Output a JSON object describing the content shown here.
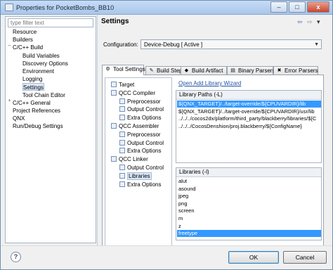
{
  "window": {
    "title": "Properties for PocketBombs_BB10",
    "controls": [
      "–",
      "□",
      "x"
    ]
  },
  "filter": {
    "placeholder": "type filter text"
  },
  "tree": [
    {
      "label": "Resource",
      "indent": 0,
      "expander": ""
    },
    {
      "label": "Builders",
      "indent": 0,
      "expander": ""
    },
    {
      "label": "C/C++ Build",
      "indent": 0,
      "expander": "–"
    },
    {
      "label": "Build Variables",
      "indent": 1,
      "expander": ""
    },
    {
      "label": "Discovery Options",
      "indent": 1,
      "expander": ""
    },
    {
      "label": "Environment",
      "indent": 1,
      "expander": ""
    },
    {
      "label": "Logging",
      "indent": 1,
      "expander": ""
    },
    {
      "label": "Settings",
      "indent": 1,
      "expander": "",
      "selected": true
    },
    {
      "label": "Tool Chain Editor",
      "indent": 1,
      "expander": ""
    },
    {
      "label": "C/C++ General",
      "indent": 0,
      "expander": "+"
    },
    {
      "label": "Project References",
      "indent": 0,
      "expander": ""
    },
    {
      "label": "QNX",
      "indent": 0,
      "expander": ""
    },
    {
      "label": "Run/Debug Settings",
      "indent": 0,
      "expander": ""
    }
  ],
  "settings": {
    "title": "Settings",
    "nav_back": "⇦",
    "nav_fwd": "⇨",
    "menu": "▾"
  },
  "configuration": {
    "label": "Configuration:",
    "value": "Device-Debug  [ Active ]"
  },
  "tabs": [
    {
      "label": "Tool Settings",
      "icon": "gear-icon",
      "active": true
    },
    {
      "label": "Build Steps",
      "icon": "wrench-icon",
      "active": false
    },
    {
      "label": "Build Artifact",
      "icon": "artifact-icon",
      "active": false
    },
    {
      "label": "Binary Parsers",
      "icon": "binary-icon",
      "active": false
    },
    {
      "label": "Error Parsers",
      "icon": "error-icon",
      "active": false
    }
  ],
  "tool_tree": [
    {
      "label": "Target",
      "indent": 1
    },
    {
      "label": "QCC Compiler",
      "indent": 1
    },
    {
      "label": "Preprocessor",
      "indent": 2
    },
    {
      "label": "Output Control",
      "indent": 2
    },
    {
      "label": "Extra Options",
      "indent": 2
    },
    {
      "label": "QCC Assembler",
      "indent": 1
    },
    {
      "label": "Preprocessor",
      "indent": 2
    },
    {
      "label": "Output Control",
      "indent": 2
    },
    {
      "label": "Extra Options",
      "indent": 2
    },
    {
      "label": "QCC Linker",
      "indent": 1
    },
    {
      "label": "Output Control",
      "indent": 2
    },
    {
      "label": "Libraries",
      "indent": 2,
      "selected": true
    },
    {
      "label": "Extra Options",
      "indent": 2
    }
  ],
  "open_library_wizard": "Open Add Library Wizard",
  "library_paths": {
    "header": "Library Paths (-L)",
    "items": [
      "${QNX_TARGET}/../target-override/${CPUVARDIR}/lib",
      "${QNX_TARGET}/../target-override/${CPUVARDIR}/usr/lib",
      "../../../cocos2dx/platform/third_party/blackberry/libraries/${C",
      "../../../CocosDenshion/proj.blackberry/${ConfigName}"
    ],
    "highlight_index": 0
  },
  "libraries": {
    "header": "Libraries (-l)",
    "items": [
      "alut",
      "asound",
      "jpeg",
      "png",
      "screen",
      "m",
      "z",
      "freetype"
    ],
    "highlight_index": 7
  },
  "buttons": {
    "help": "?",
    "ok": "OK",
    "cancel": "Cancel"
  },
  "colors": {
    "selection": "#3399ff",
    "link": "#2355a5"
  }
}
